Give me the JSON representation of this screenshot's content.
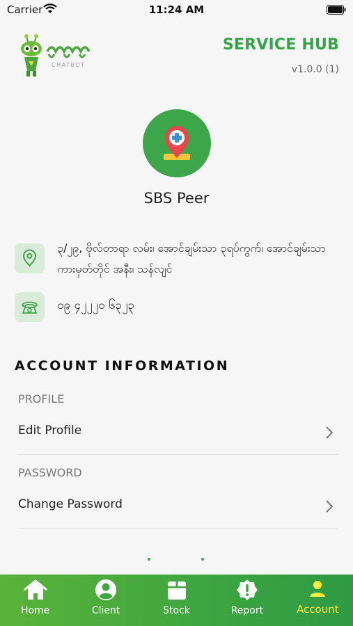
{
  "status_bar": {
    "carrier": "Carrier",
    "time": "11:24 AM"
  },
  "header": {
    "logo_text": "CHATBOT",
    "title": "SERVICE HUB",
    "version": "v1.0.0 (1)"
  },
  "profile": {
    "name": "SBS Peer",
    "address": "၃/၂၉, ဗိုလ်တာရာ လမ်း၊ အောင်ချမ်းသာ ၃ရပ်ကွက်၊ အောင်ချမ်းသာကားမှတ်တိုင် အနီး၊ သန်လျင်",
    "phone": "၀၉ ၄၂၂၂၀ ၆၃၂၃"
  },
  "account": {
    "heading": "ACCOUNT INFORMATION",
    "profile_group": "PROFILE",
    "edit_profile": "Edit Profile",
    "password_group": "PASSWORD",
    "change_password": "Change Password"
  },
  "tabs": [
    {
      "label": "Home",
      "icon": "home-icon"
    },
    {
      "label": "Client",
      "icon": "user-circle-icon"
    },
    {
      "label": "Stock",
      "icon": "box-icon"
    },
    {
      "label": "Report",
      "icon": "alert-badge-icon"
    },
    {
      "label": "Account",
      "icon": "person-icon"
    }
  ],
  "colors": {
    "brand_green": "#37a349",
    "active_tab": "#ffec3d",
    "icon_bg": "#d9ecd9"
  }
}
